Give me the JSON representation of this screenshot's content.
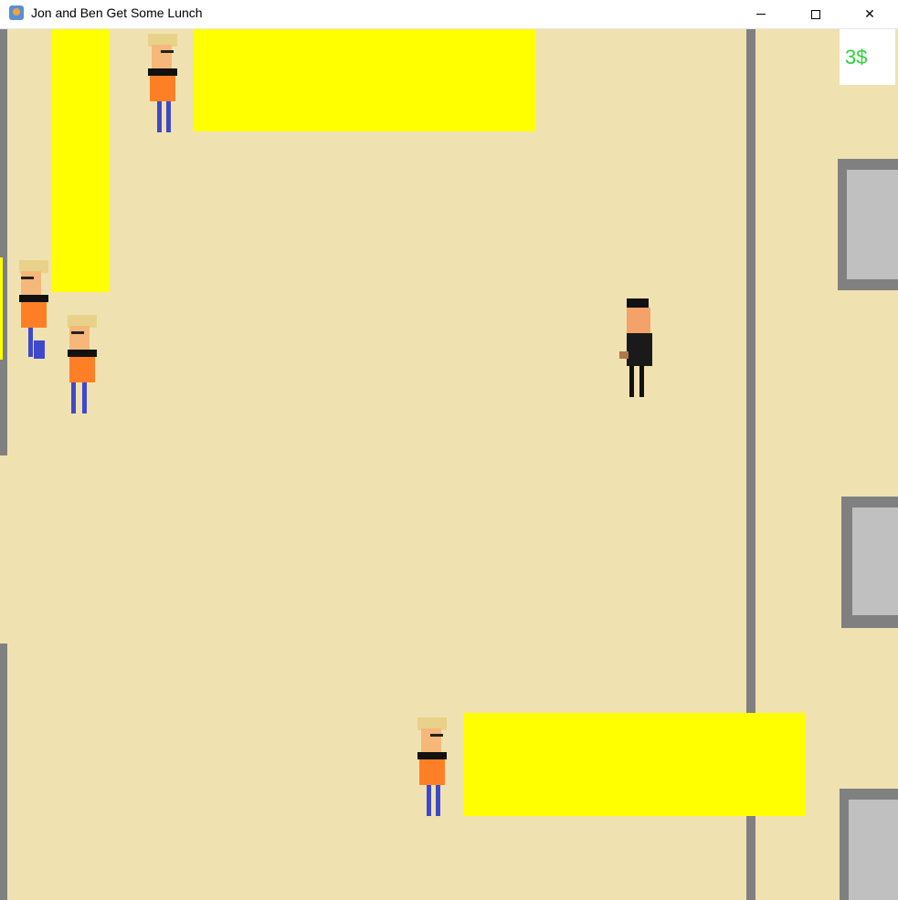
{
  "window": {
    "title": "Jon and Ben Get Some Lunch"
  },
  "controls": {
    "minimize": "minimize",
    "maximize": "maximize",
    "close": "close"
  },
  "hud": {
    "money": "3$"
  },
  "colors": {
    "floor": "#f0e2b0",
    "wall": "#808080",
    "table": "#ffff00",
    "door_frame": "#808080",
    "door_panel": "#c0c0c0",
    "money_text": "#2ad33a",
    "npc_hair": "#e8d28a",
    "npc_shirt": "#ff7f27",
    "npc_pants": "#3f48cc",
    "player_clothes": "#1a1a1a"
  }
}
